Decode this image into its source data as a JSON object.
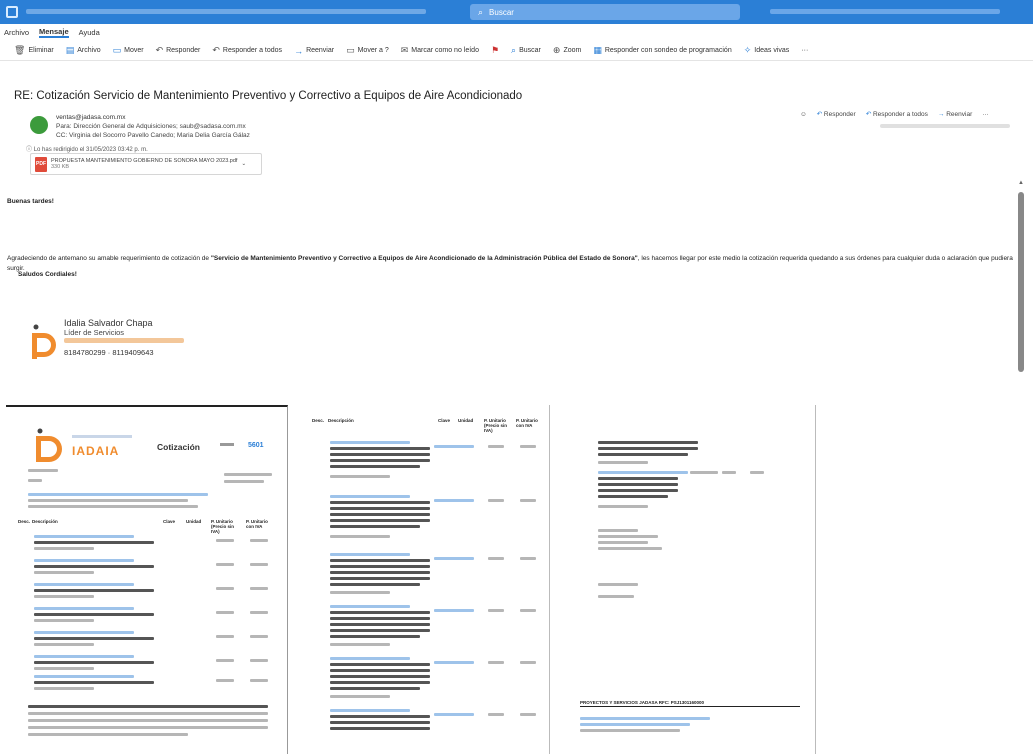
{
  "window": {
    "search_placeholder": "Buscar"
  },
  "menu": {
    "tabs": [
      {
        "label": "Archivo"
      },
      {
        "label": "Mensaje"
      },
      {
        "label": "Ayuda"
      }
    ]
  },
  "ribbon": {
    "buttons": [
      {
        "label": "Eliminar",
        "icon": "trash-icon"
      },
      {
        "label": "Archivo",
        "icon": "archive-icon"
      },
      {
        "label": "Mover",
        "icon": "folder-icon"
      },
      {
        "label": "Responder",
        "icon": "reply-icon"
      },
      {
        "label": "Responder a todos",
        "icon": "reply-all-icon"
      },
      {
        "label": "Reenviar",
        "icon": "forward-icon"
      },
      {
        "label": "Mover a ?",
        "icon": "move-icon"
      },
      {
        "label": "Marcar como no leído",
        "icon": "mail-icon"
      },
      {
        "label": "Buscar",
        "icon": "search-icon"
      },
      {
        "label": "Zoom",
        "icon": "zoom-icon"
      },
      {
        "label": "Responder con sondeo de programación",
        "icon": "calendar-icon"
      },
      {
        "label": "Ideas vivas",
        "icon": "bulb-icon"
      }
    ],
    "more": "···"
  },
  "message": {
    "subject": "RE: Cotización Servicio de Mantenimiento Preventivo y Correctivo a Equipos de Aire Acondicionado",
    "from": "ventas@jadasa.com.mx",
    "to": "Para: Dirección General de Adquisiciones; saub@sadasa.com.mx",
    "cc": "CC: Virginia del Socorro Pavello Canedo; Maria Delia García Gálaz",
    "redirect_note": "Lo has redirigido el 31/05/2023 03:42 p. m.",
    "attachment": {
      "name": "PROPUESTA MANTENIMIENTO GOBIERNO DE SONORA MAYO 2023.pdf",
      "size": "330 KB",
      "type_label": "PDF"
    },
    "actions": {
      "reply": "Responder",
      "reply_all": "Responder a todos",
      "forward": "Reenviar",
      "more": "···"
    },
    "body": {
      "greeting": "Buenas tardes!",
      "paragraph_prefix": "Agradeciendo de antemano su amable requerimiento de cotización de ",
      "paragraph_bold": "\"Servicio de Mantenimiento Preventivo y Correctivo a Equipos de Aire Acondicionado de la Administración Pública del Estado de Sonora\"",
      "paragraph_suffix": ", les hacemos llegar por este medio la cotización requerida quedando a sus órdenes para cualquier duda o aclaración que pudiera surgir.",
      "closing": "Saludos Cordiales!"
    },
    "signature": {
      "name": "Idalia Salvador Chapa",
      "role": "Líder de Servicios",
      "phones": "8184780299 · 8119409643"
    }
  },
  "documents": {
    "page1": {
      "brand": "IADAIA",
      "title": "Cotización",
      "folio": "5601",
      "headers": [
        "Desc.",
        "Descripción",
        "Clave",
        "Unidad",
        "P. Unitario (Precio sin IVA)",
        "P. Unitario con IVA"
      ]
    },
    "page2": {
      "headers": [
        "Desc.",
        "Descripción",
        "Clave",
        "Unidad",
        "P. Unitario (Precio sin IVA)",
        "P. Unitario con IVA"
      ]
    },
    "page3": {
      "footer_title": "PROYECTOS Y SERVICIOS JADASA    RFC: PSJ1301160000"
    }
  },
  "colors": {
    "accent": "#2b7fd6",
    "brand_orange": "#f08c2e"
  }
}
